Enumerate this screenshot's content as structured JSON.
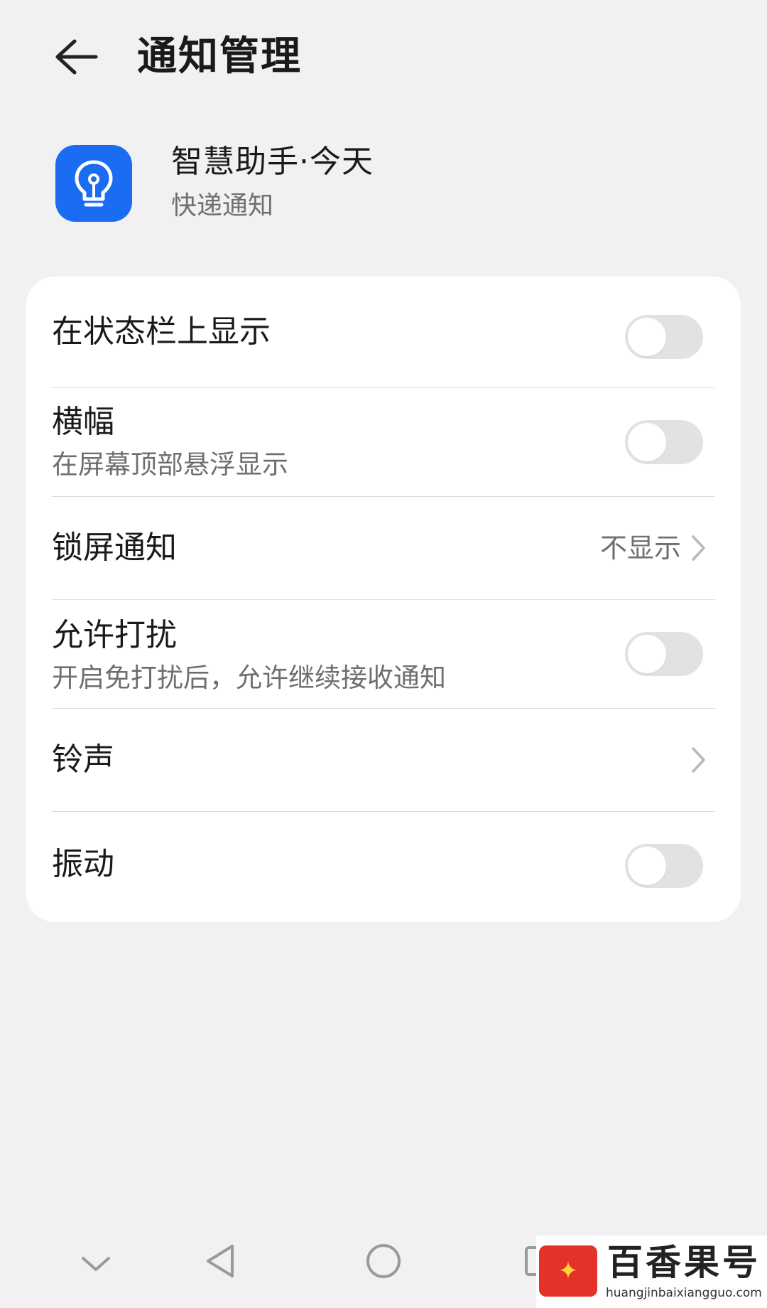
{
  "header": {
    "title": "通知管理"
  },
  "app": {
    "name": "智慧助手·今天",
    "subtitle": "快递通知",
    "icon_color": "#1a6cf2"
  },
  "settings": [
    {
      "title": "在状态栏上显示",
      "control": "toggle",
      "on": false
    },
    {
      "title": "横幅",
      "subtitle": "在屏幕顶部悬浮显示",
      "control": "toggle",
      "on": false
    },
    {
      "title": "锁屏通知",
      "value": "不显示",
      "control": "chevron"
    },
    {
      "title": "允许打扰",
      "subtitle": "开启免打扰后，允许继续接收通知",
      "control": "toggle",
      "on": false
    },
    {
      "title": "铃声",
      "control": "chevron"
    },
    {
      "title": "振动",
      "control": "toggle",
      "on": false
    }
  ],
  "nav": {
    "icons": [
      "chevron-down-icon",
      "back-triangle-icon",
      "home-circle-icon",
      "recents-square-icon"
    ]
  },
  "watermark": {
    "title": "百香果号",
    "url": "huangjinbaixiangguo.com"
  }
}
